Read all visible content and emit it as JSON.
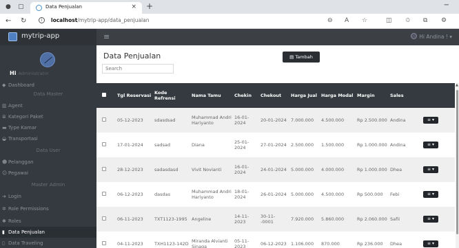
{
  "browser": {
    "tab_title": "Data Penjualan",
    "url_host": "localhost",
    "url_path": "/mytrip-app/data_penjualan"
  },
  "app": {
    "name": "mytrip-app",
    "user": "Hi Andina !"
  },
  "sidebar": {
    "greeting": "Hi",
    "role": "Administrator",
    "items": [
      {
        "label": "Dashboard",
        "icon": "dashboard-icon",
        "type": "item"
      },
      {
        "label": "Data Master",
        "type": "header"
      },
      {
        "label": "Agent",
        "icon": "bank-icon",
        "type": "item"
      },
      {
        "label": "Kategori Paket",
        "icon": "list-icon",
        "type": "item"
      },
      {
        "label": "Type Kamar",
        "icon": "bed-icon",
        "type": "item"
      },
      {
        "label": "Transportasi",
        "icon": "car-icon",
        "type": "item"
      },
      {
        "label": "Data User",
        "type": "header"
      },
      {
        "label": "Pelanggan",
        "icon": "users-icon",
        "type": "item"
      },
      {
        "label": "Pegawai",
        "icon": "user-tie-icon",
        "type": "item"
      },
      {
        "label": "Master Admin",
        "type": "header"
      },
      {
        "label": "Login",
        "icon": "login-icon",
        "type": "item"
      },
      {
        "label": "Role Permissions",
        "icon": "gears-icon",
        "type": "item"
      },
      {
        "label": "Roles",
        "icon": "gear-icon",
        "type": "item"
      },
      {
        "label": "Data Penjualan",
        "icon": "file-icon",
        "type": "item",
        "active": true
      },
      {
        "label": "Data Traveling",
        "icon": "file-outline-icon",
        "type": "item"
      }
    ]
  },
  "main": {
    "title": "Data Penjualan",
    "add_button": "Tambah",
    "search_placeholder": "Search",
    "columns": [
      "Tgl Reservasi",
      "Kode Refrensi",
      "Nama Tamu",
      "Chekin",
      "Chekout",
      "Harga Jual",
      "Harga Modal",
      "Margin",
      "Sales"
    ],
    "rows": [
      {
        "tgl": "05-12-2023",
        "kode": "sdasdsad",
        "nama": "Muhammad Andri Hariyanto",
        "chekin": "16-01-2024",
        "chekout": "20-01-2024",
        "jual": "7.000.000",
        "modal": "4.500.000",
        "margin": "Rp 2.500.000",
        "sales": "Andina"
      },
      {
        "tgl": "17-01-2024",
        "kode": "sadsad",
        "nama": "Diana",
        "chekin": "25-01-2024",
        "chekout": "27-01-2024",
        "jual": "2.500.000",
        "modal": "1.500.000",
        "margin": "Rp 1.000.000",
        "sales": "Andina"
      },
      {
        "tgl": "28-12-2023",
        "kode": "sadasdasd",
        "nama": "Vivit Novianti",
        "chekin": "16-01-2024",
        "chekout": "24-01-2024",
        "jual": "5.000.000",
        "modal": "4.000.000",
        "margin": "Rp 1.000.000",
        "sales": "Dhea"
      },
      {
        "tgl": "06-12-2023",
        "kode": "dasdas",
        "nama": "Muhammad Andri Hariyanto",
        "chekin": "18-01-2024",
        "chekout": "26-01-2024",
        "jual": "5.000.000",
        "modal": "4.500.000",
        "margin": "Rp 500.000",
        "sales": "Febi"
      },
      {
        "tgl": "06-11-2023",
        "kode": "TXT1123-1995",
        "nama": "Angeline",
        "chekin": "14-11-2023",
        "chekout": "30-11--0001",
        "jual": "7.920.000",
        "modal": "5.860.000",
        "margin": "Rp 2.060.000",
        "sales": "Safii"
      },
      {
        "tgl": "04-11-2023",
        "kode": "TXH1123-142D",
        "nama": "Miranda Alvianti Sinaga",
        "chekin": "05-11-2023",
        "chekout": "06-12-2023",
        "jual": "1.106.000",
        "modal": "870.000",
        "margin": "Rp 236.000",
        "sales": "Dhea"
      }
    ]
  }
}
